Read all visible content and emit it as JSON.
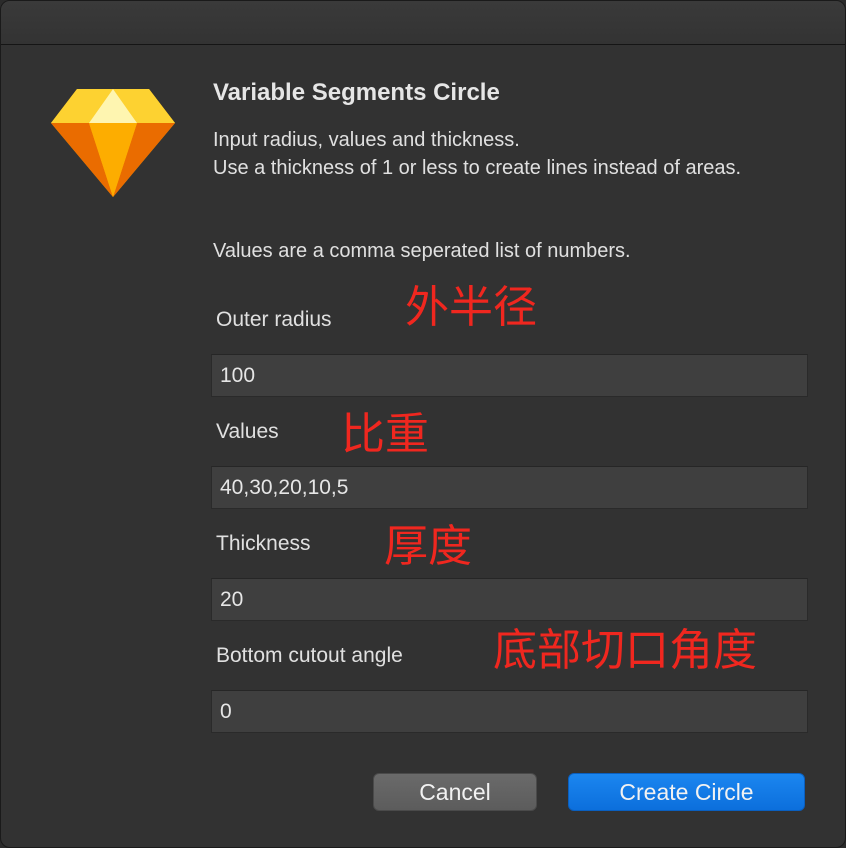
{
  "dialog": {
    "title": "Variable Segments Circle",
    "description_line1": "Input radius, values and thickness.",
    "description_line2": "Use a thickness of 1 or less to create lines instead of areas.",
    "description_line3": "Values are a comma seperated list of numbers."
  },
  "fields": {
    "outer_radius": {
      "label": "Outer radius",
      "value": "100",
      "annotation": "外半径"
    },
    "values": {
      "label": "Values",
      "value": "40,30,20,10,5",
      "annotation": "比重"
    },
    "thickness": {
      "label": "Thickness",
      "value": "20",
      "annotation": "厚度"
    },
    "cutout": {
      "label": "Bottom cutout angle",
      "value": "0",
      "annotation": "底部切口角度"
    }
  },
  "buttons": {
    "cancel": "Cancel",
    "create": "Create Circle"
  },
  "icons": {
    "app": "sketch-diamond-icon"
  },
  "colors": {
    "background": "#323232",
    "accent": "#1477e6",
    "annotation": "#f0271f"
  }
}
